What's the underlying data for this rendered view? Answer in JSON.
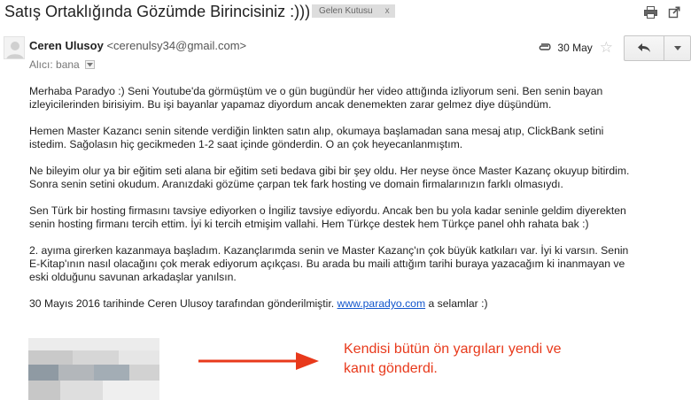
{
  "subject": "Satış Ortaklığında Gözümde Birincisiniz :)))",
  "label_chip": {
    "text": "Gelen Kutusu",
    "close": "x"
  },
  "sender": {
    "name": "Ceren Ulusoy",
    "email": "<cerenulsy34@gmail.com>"
  },
  "recipient": {
    "label": "Alıcı:",
    "value": "bana"
  },
  "meta": {
    "date": "30 May",
    "star": "☆"
  },
  "icons": {
    "print": "print-icon",
    "new_window": "new-window-icon",
    "reply": "reply-icon",
    "more": "chevron-down-icon",
    "attachment": "paperclip-icon"
  },
  "body": {
    "p1": [
      "Merhaba Paradyo :) Seni Youtube'da görmüştüm ve o gün bugündür her video attığında izliyorum seni. Ben senin bayan",
      "izleyicilerinden birisiyim. Bu işi bayanlar yapamaz diyordum ancak denemekten zarar gelmez diye düşündüm."
    ],
    "p2": [
      "Hemen Master Kazancı senin sitende verdiğin linkten satın alıp, okumaya başlamadan sana mesaj atıp, ClickBank setini",
      "istedim. Sağolasın hiç gecikmeden 1-2 saat içinde gönderdin. O an çok heyecanlanmıştım."
    ],
    "p3": [
      "Ne bileyim olur ya bir eğitim seti alana bir eğitim seti bedava gibi bir şey oldu. Her neyse önce Master Kazanç okuyup bitirdim.",
      "Sonra senin setini okudum. Aranızdaki gözüme çarpan tek fark hosting ve domain firmalarınızın farklı olmasıydı."
    ],
    "p4": [
      "Sen Türk bir hosting firmasını tavsiye ediyorken o İngiliz tavsiye ediyordu. Ancak ben bu yola kadar seninle geldim diyerekten",
      "senin hosting firmanı tercih ettim. İyi ki tercih etmişim vallahi. Hem Türkçe destek hem Türkçe panel ohh rahata bak :)"
    ],
    "p5": [
      "2. ayıma girerken kazanmaya başladım. Kazançlarımda senin ve Master Kazanç'ın çok büyük katkıları var. İyi ki varsın. Senin",
      "E-Kitap'ının nasıl olacağını çok merak ediyorum açıkçası. Bu arada bu maili attığım tarihi buraya yazacağım ki inanmayan ve",
      "eski olduğunu savunan arkadaşlar yanılsın."
    ],
    "p6": {
      "before": "30 Mayıs 2016 tarihinde Ceren Ulusoy tarafından gönderilmiştir. ",
      "link": "www.paradyo.com",
      "after": " a selamlar :)"
    }
  },
  "annotation": {
    "lines": [
      "Kendisi bütün ön yargıları yendi ve",
      "kanıt gönderdi."
    ],
    "color": "#e8391b"
  },
  "colors": {
    "link": "#1155cc",
    "chip_bg": "#dddddd",
    "arrow": "#e8391b"
  }
}
